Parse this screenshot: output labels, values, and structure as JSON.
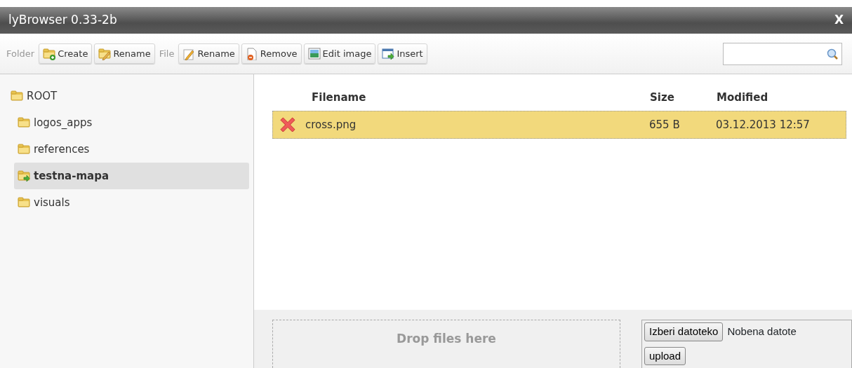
{
  "window": {
    "title": "lyBrowser 0.33-2b",
    "close": "X"
  },
  "toolbar": [
    {
      "kind": "label",
      "text": "Folder"
    },
    {
      "kind": "button",
      "text": "Create"
    },
    {
      "kind": "button",
      "text": "Rename"
    },
    {
      "kind": "label",
      "text": "File"
    },
    {
      "kind": "button",
      "text": "Rename"
    },
    {
      "kind": "button",
      "text": "Remove"
    },
    {
      "kind": "button",
      "text": "Edit image"
    },
    {
      "kind": "button",
      "text": "Insert"
    }
  ],
  "tree": [
    {
      "label": "ROOT",
      "selected": false,
      "children": [
        {
          "label": "logos_apps",
          "selected": false
        },
        {
          "label": "references",
          "selected": false
        },
        {
          "label": "testna-mapa",
          "selected": true
        },
        {
          "label": "visuals",
          "selected": false
        }
      ]
    }
  ],
  "table": {
    "columns": [
      "Filename",
      "Size",
      "Modified"
    ],
    "rows": [
      {
        "name": "cross.png",
        "size": "655 B",
        "modified": "03.12.2013 12:57",
        "selected": true
      }
    ]
  },
  "dropzone": {
    "text": "Drop files here"
  },
  "upload": {
    "choose_button": "Izberi datoteko",
    "no_file_text": "Nobena datote",
    "submit_button": "upload"
  }
}
